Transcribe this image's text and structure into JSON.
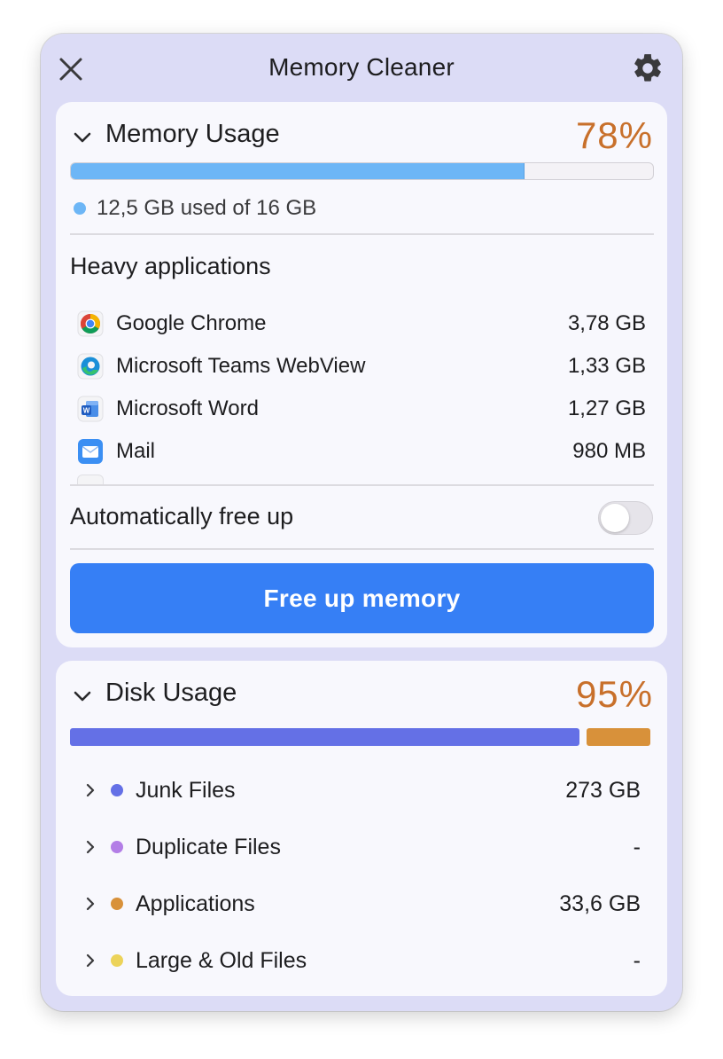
{
  "window": {
    "title": "Memory Cleaner"
  },
  "colors": {
    "accent_blue": "#367ff5",
    "percent_orange": "#c8702b",
    "memory_bar": "#6db6f6",
    "junk": "#6470e6",
    "duplicate": "#b37ee6",
    "applications": "#d8913a",
    "large_old": "#ecd35a"
  },
  "memory": {
    "title": "Memory Usage",
    "percent": "78%",
    "usage_fraction": 0.78,
    "used_text": "12,5 GB used of 16 GB",
    "heavy_title": "Heavy applications",
    "apps": [
      {
        "name": "Google Chrome",
        "size": "3,78 GB",
        "icon": "chrome-icon"
      },
      {
        "name": "Microsoft Teams WebView",
        "size": "1,33 GB",
        "icon": "edge-icon"
      },
      {
        "name": "Microsoft Word",
        "size": "1,27 GB",
        "icon": "word-icon"
      },
      {
        "name": "Mail",
        "size": "980 MB",
        "icon": "mail-icon"
      }
    ],
    "auto_label": "Automatically free up",
    "auto_enabled": false,
    "button_label": "Free up memory"
  },
  "disk": {
    "title": "Disk Usage",
    "percent": "95%",
    "segments": [
      {
        "category": "Junk Files",
        "fraction": 0.89
      },
      {
        "category": "Applications",
        "fraction": 0.11
      }
    ],
    "items": [
      {
        "name": "Junk Files",
        "value": "273 GB",
        "color": "#6470e6"
      },
      {
        "name": "Duplicate Files",
        "value": "-",
        "color": "#b37ee6"
      },
      {
        "name": "Applications",
        "value": "33,6 GB",
        "color": "#d8913a"
      },
      {
        "name": "Large & Old Files",
        "value": "-",
        "color": "#ecd35a"
      }
    ]
  }
}
